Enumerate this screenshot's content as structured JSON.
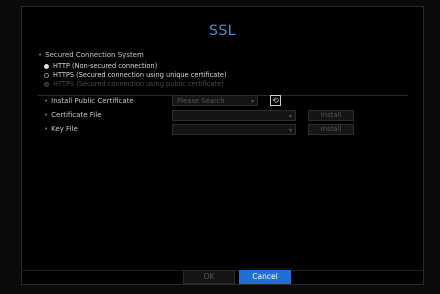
{
  "dialog": {
    "title": "SSL",
    "secured_section_label": "Secured Connection System",
    "options": [
      {
        "label": "HTTP (Non-secured connection)",
        "checked": true,
        "enabled": true
      },
      {
        "label": "HTTPS (Secured connection using unique certificate)",
        "checked": false,
        "enabled": true
      },
      {
        "label": "HTTPS (Secured connection using public certificate)",
        "checked": false,
        "enabled": false
      }
    ],
    "install_public_label": "Install Public Certificate",
    "install_public_placeholder": "Please Search",
    "refresh_icon": "refresh-icon",
    "certificate_file_label": "Certificate File",
    "certificate_install_label": "Install",
    "key_file_label": "Key File",
    "key_install_label": "Install",
    "ok_label": "OK",
    "cancel_label": "Cancel"
  },
  "colors": {
    "accent": "#1f6fd6",
    "title": "#4f8be0"
  }
}
